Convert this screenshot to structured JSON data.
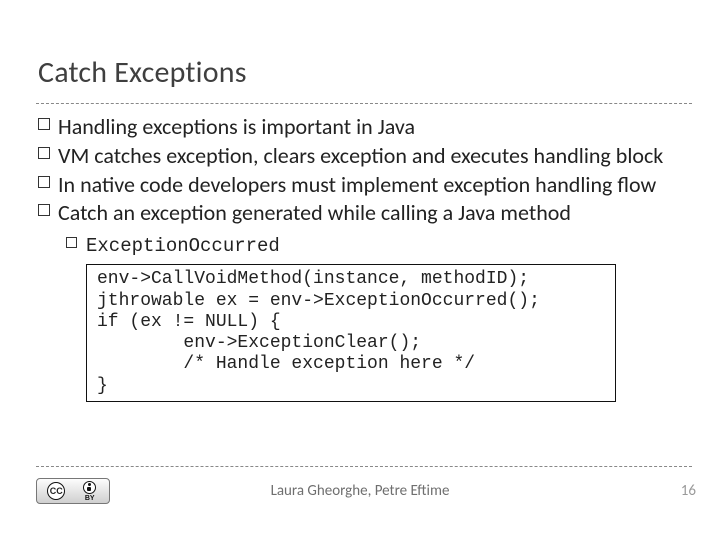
{
  "title": "Catch Exceptions",
  "bullets": {
    "b1": "Handling exceptions is important in Java",
    "b2": "VM catches exception, clears exception and executes handling block",
    "b3": "In native code developers must implement exception handling flow",
    "b4": "Catch an exception generated while calling a Java method",
    "sub1": "ExceptionOccurred"
  },
  "code": "env->CallVoidMethod(instance, methodID);\njthrowable ex = env->ExceptionOccurred();\nif (ex != NULL) {\n        env->ExceptionClear();\n        /* Handle exception here */\n}",
  "footer": {
    "authors": "Laura Gheorghe, Petre Eftime",
    "page": "16"
  },
  "cc": {
    "cc": "CC",
    "by": "BY"
  }
}
